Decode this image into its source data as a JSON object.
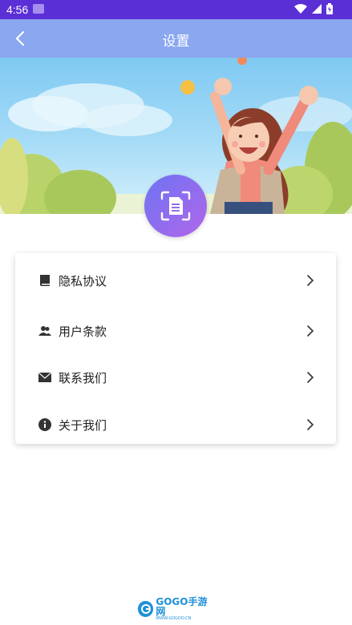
{
  "status_bar": {
    "time": "4:56"
  },
  "nav": {
    "title": "设置"
  },
  "menu": {
    "items": [
      {
        "label": "隐私协议",
        "icon": "book-icon"
      },
      {
        "label": "用户条款",
        "icon": "users-icon"
      },
      {
        "label": "联系我们",
        "icon": "envelope-icon"
      },
      {
        "label": "关于我们",
        "icon": "info-icon"
      }
    ]
  },
  "footer": {
    "brand": "GOGO手游网",
    "url": "WWW.GOGOO.CN"
  },
  "colors": {
    "status": "#5b2fd6",
    "nav": "#8aa7f0",
    "accent_start": "#6c74f3",
    "accent_end": "#b266ea"
  }
}
